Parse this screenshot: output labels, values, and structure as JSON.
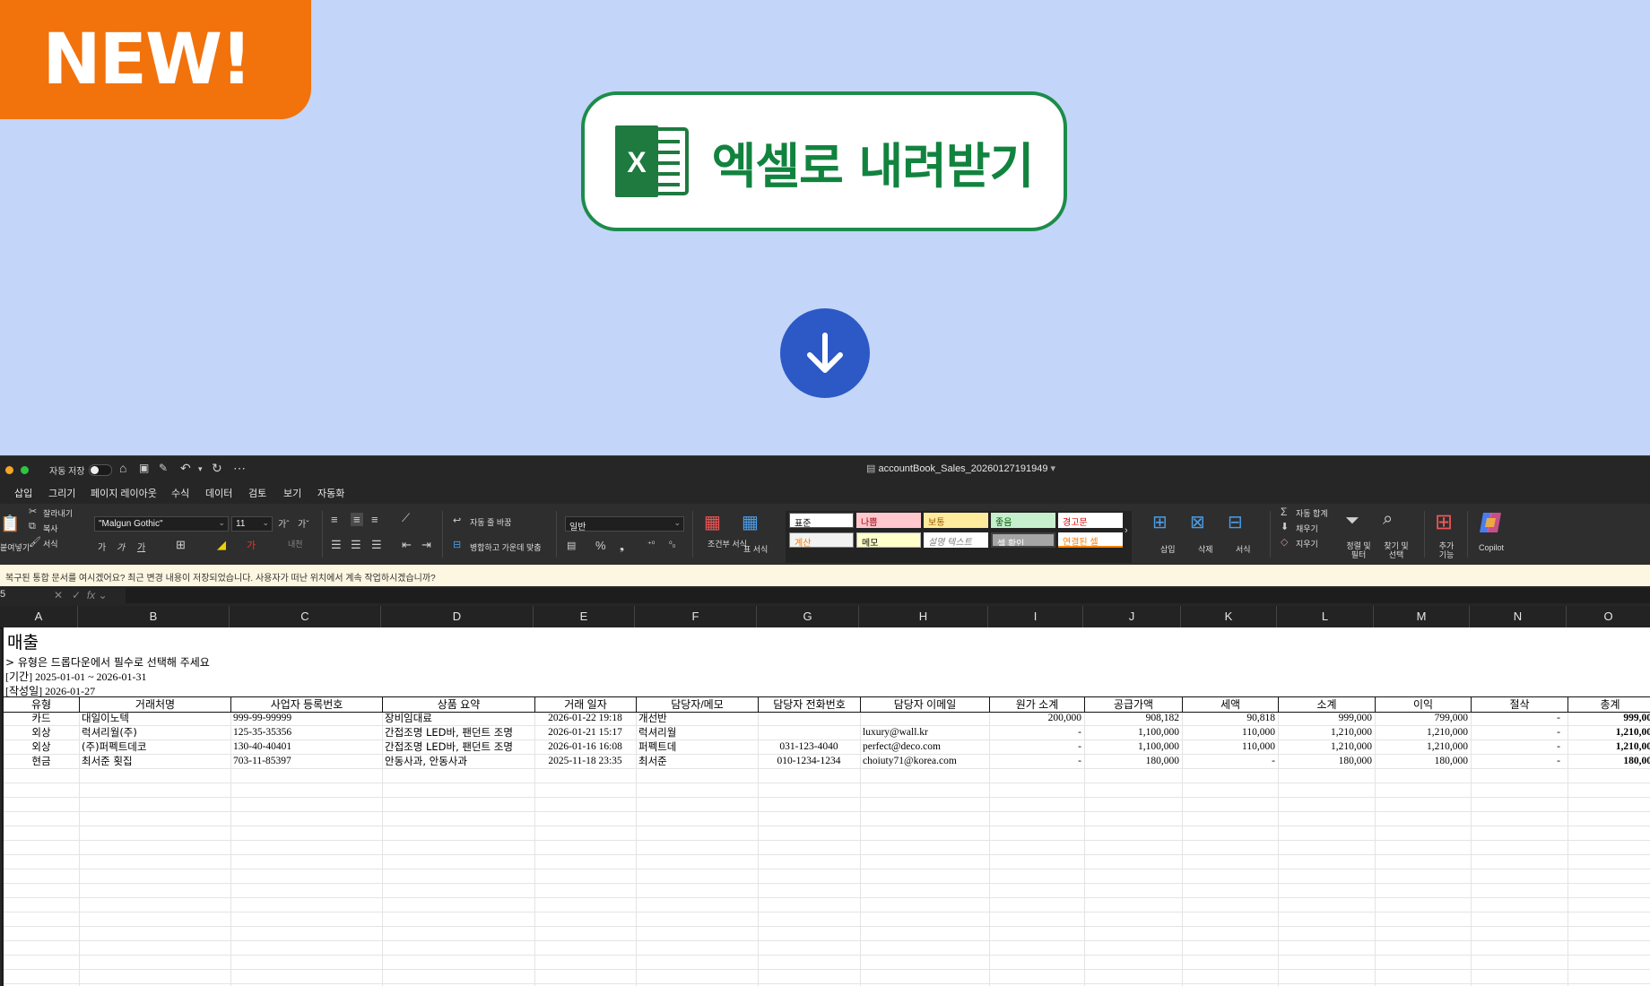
{
  "badge": {
    "text": "NEW!"
  },
  "download": {
    "label": "엑셀로 내려받기"
  },
  "colors": {
    "background": "#c3d5f9",
    "badge": "#f2720c",
    "accent_green": "#12833f",
    "arrow_blue": "#2c59c6"
  },
  "excel": {
    "window_title": "accountBook_Sales_20260127191949",
    "autosave_label": "자동 저장",
    "menu": [
      "삽입",
      "그리기",
      "페이지 레이아웃",
      "수식",
      "데이터",
      "검토",
      "보기",
      "자동화"
    ],
    "ribbon": {
      "paste": "붙여넣기",
      "cut": "잘라내기",
      "copy": "복사",
      "format_painter": "서식",
      "font": "\"Malgun Gothic\"",
      "font_size": "11",
      "wrap_text": "자동 줄 바꿈",
      "merge_center": "병합하고 가운데 맞춤",
      "number_format": "일반",
      "conditional_format": "조건부 서식",
      "table_format": "표 서식",
      "styles": [
        "표준",
        "나쁨",
        "보통",
        "좋음",
        "경고문",
        "계산",
        "메모",
        "설명 텍스트",
        "셀 확인",
        "연결된 셀"
      ],
      "insert": "삽입",
      "delete": "삭제",
      "format": "서식",
      "autosum": "자동 합계",
      "fill": "채우기",
      "clear": "지우기",
      "sort_filter": "정렬 및 필터",
      "find_select": "찾기 및 선택",
      "addins": "추가 기능",
      "copilot": "Copilot"
    },
    "notification": "복구된 통합 문서를 여시겠어요?   최근 변경 내용이 저장되었습니다. 사용자가 떠난 위치에서 계속 작업하시겠습니까?",
    "name_box": "5",
    "columns": [
      "A",
      "B",
      "C",
      "D",
      "E",
      "F",
      "G",
      "H",
      "I",
      "J",
      "K",
      "L",
      "M",
      "N",
      "O"
    ],
    "sheet": {
      "title": "매출",
      "note": "> 유형은 드롭다운에서 필수로 선택해 주세요",
      "period": "[기간] 2025-01-01 ~ 2026-01-31",
      "created": "[작성일] 2026-01-27",
      "headers": [
        "유형",
        "거래처명",
        "사업자 등록번호",
        "상품 요약",
        "거래 일자",
        "담당자/메모",
        "담당자 전화번호",
        "담당자 이메일",
        "원가 소계",
        "공급가액",
        "세액",
        "소계",
        "이익",
        "절삭",
        "총계"
      ],
      "rows": [
        [
          "카드",
          "대일이노텍",
          "999-99-99999",
          "장비임대료",
          "2026-01-22 19:18",
          "개선반",
          "",
          "",
          "200,000",
          "908,182",
          "90,818",
          "999,000",
          "799,000",
          "-",
          "999,00"
        ],
        [
          "외상",
          "럭셔리월(주)",
          "125-35-35356",
          "간접조명 LED바, 팬던트 조명",
          "2026-01-21 15:17",
          "럭셔리월",
          "",
          "luxury@wall.kr",
          "-",
          "1,100,000",
          "110,000",
          "1,210,000",
          "1,210,000",
          "-",
          "1,210,00"
        ],
        [
          "외상",
          "(주)퍼펙트데코",
          "130-40-40401",
          "간접조명 LED바, 팬던트 조명",
          "2026-01-16 16:08",
          "퍼펙트데",
          "031-123-4040",
          "perfect@deco.com",
          "-",
          "1,100,000",
          "110,000",
          "1,210,000",
          "1,210,000",
          "-",
          "1,210,00"
        ],
        [
          "현금",
          "최서준 횟집",
          "703-11-85397",
          "안동사과, 안동사과",
          "2025-11-18 23:35",
          "최서준",
          "010-1234-1234",
          "choiuty71@korea.com",
          "-",
          "180,000",
          "-",
          "180,000",
          "180,000",
          "-",
          "180,00"
        ]
      ]
    }
  }
}
